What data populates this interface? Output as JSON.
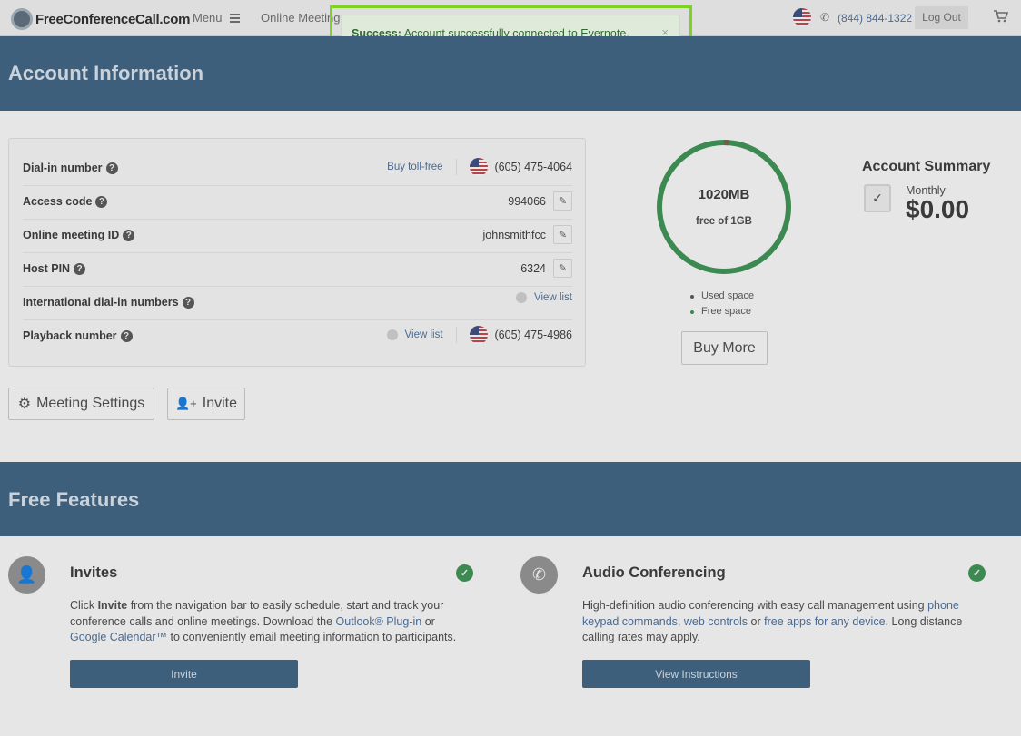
{
  "header": {
    "logo_text": "FreeConferenceCall.com",
    "menu_label": "Menu",
    "online_label": "Online Meeting",
    "phone": "(844) 844-1322",
    "logout_label": "Log Out"
  },
  "toast": {
    "strong": "Success:",
    "message": "Account successfully connected to Evernote.",
    "close": "×"
  },
  "account": {
    "title": "Account Information",
    "rows": [
      {
        "label": "Dial-in number",
        "link": "Buy toll-free",
        "value": "(605) 475-4064"
      },
      {
        "label": "Access code",
        "value": "994066"
      },
      {
        "label": "Online meeting ID",
        "value": "johnsmithfcc"
      },
      {
        "label": "Host PIN",
        "value": "6324"
      },
      {
        "label": "International dial-in numbers",
        "link": "View list"
      },
      {
        "label": "Playback number",
        "link": "View list",
        "value": "(605) 475-4986"
      }
    ],
    "settings_btn": "Meeting Settings",
    "invite_btn": "Invite"
  },
  "storage": {
    "used": "1020MB",
    "of": "free of 1GB",
    "used_fraction": 0.996,
    "legend_used": "Used space",
    "legend_free": "Free space",
    "buy_more": "Buy More",
    "colors": {
      "used": "#7a5a4a",
      "free": "#3c8a52"
    }
  },
  "summary": {
    "title": "Account Summary",
    "plan": "Monthly",
    "price": "$0.00"
  },
  "features": {
    "title": "Free Features",
    "invites": {
      "title": "Invites",
      "t1": "Click ",
      "t_bold": "Invite",
      "t2": " from the navigation bar to easily schedule, start and track your conference calls and online meetings. Download the ",
      "link1": "Outlook® Plug-in",
      "t3": " or ",
      "link2": "Google Calendar™",
      "t4": " to conveniently email meeting information to participants.",
      "button": "Invite"
    },
    "audio": {
      "title": "Audio Conferencing",
      "t1": "High-definition audio conferencing with easy call management using ",
      "link1": "phone keypad commands",
      "t2": ", ",
      "link2": "web controls",
      "t3": " or ",
      "link3": "free apps for any device",
      "t4": ". Long distance calling rates may apply.",
      "button": "View Instructions"
    }
  }
}
